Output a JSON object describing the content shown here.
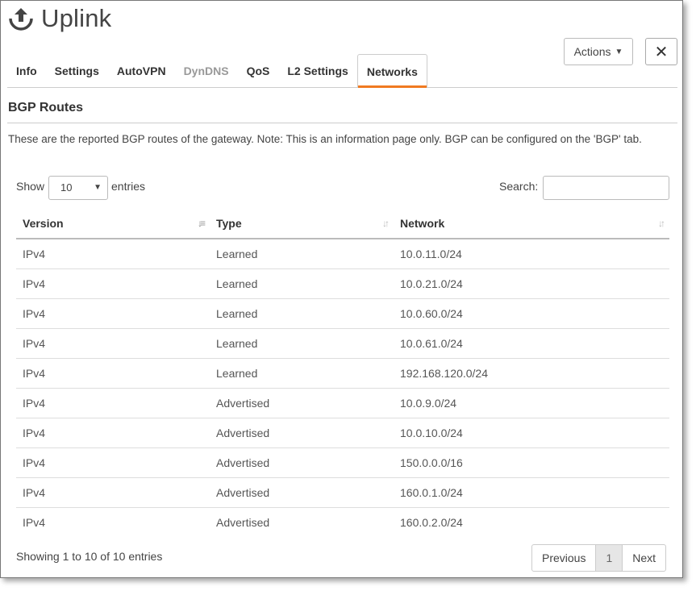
{
  "header": {
    "title": "Uplink",
    "icon": "upload-icon"
  },
  "toolbar": {
    "actions_label": "Actions",
    "close_icon": "close-icon"
  },
  "tabs": [
    {
      "label": "Info",
      "state": "normal"
    },
    {
      "label": "Settings",
      "state": "normal"
    },
    {
      "label": "AutoVPN",
      "state": "normal"
    },
    {
      "label": "DynDNS",
      "state": "disabled"
    },
    {
      "label": "QoS",
      "state": "normal"
    },
    {
      "label": "L2 Settings",
      "state": "normal"
    },
    {
      "label": "Networks",
      "state": "active"
    }
  ],
  "section": {
    "title": "BGP Routes",
    "description": "These are the reported BGP routes of the gateway. Note: This is an information page only. BGP can be configured on the 'BGP' tab."
  },
  "controls": {
    "show_label": "Show",
    "page_size": "10",
    "entries_label": "entries",
    "search_label": "Search:",
    "search_value": ""
  },
  "table": {
    "columns": [
      "Version",
      "Type",
      "Network"
    ],
    "rows": [
      [
        "IPv4",
        "Learned",
        "10.0.11.0/24"
      ],
      [
        "IPv4",
        "Learned",
        "10.0.21.0/24"
      ],
      [
        "IPv4",
        "Learned",
        "10.0.60.0/24"
      ],
      [
        "IPv4",
        "Learned",
        "10.0.61.0/24"
      ],
      [
        "IPv4",
        "Learned",
        "192.168.120.0/24"
      ],
      [
        "IPv4",
        "Advertised",
        "10.0.9.0/24"
      ],
      [
        "IPv4",
        "Advertised",
        "10.0.10.0/24"
      ],
      [
        "IPv4",
        "Advertised",
        "150.0.0.0/16"
      ],
      [
        "IPv4",
        "Advertised",
        "160.0.1.0/24"
      ],
      [
        "IPv4",
        "Advertised",
        "160.0.2.0/24"
      ]
    ]
  },
  "footer": {
    "info": "Showing 1 to 10 of 10 entries",
    "previous_label": "Previous",
    "current_page": "1",
    "next_label": "Next"
  },
  "colors": {
    "active_tab_accent": "#f07a21",
    "text": "#444444",
    "disabled_tab": "#999999"
  }
}
